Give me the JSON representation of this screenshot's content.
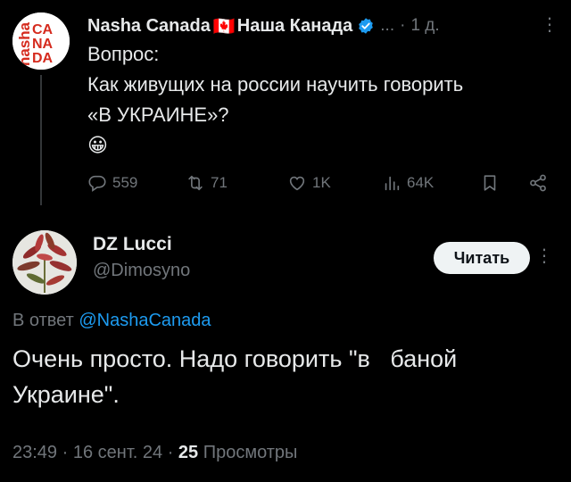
{
  "tweet": {
    "display_name": "Nasha Canada",
    "flag": "🇨🇦",
    "display_name_2": "Наша Канада",
    "ellipsis": "...",
    "separator": "·",
    "age": "1 д.",
    "more": "⋮",
    "text_lines": [
      "Вопрос:",
      "Как живущих на россии научить говорить",
      "«В УКРАИНЕ»?",
      "😀"
    ],
    "avatar_text": {
      "vertical": "nasha",
      "grid": [
        "CA",
        "NA",
        "DA"
      ]
    },
    "actions": {
      "replies": "559",
      "reposts": "71",
      "likes": "1K",
      "views": "64K"
    },
    "colors": {
      "verified": "#1d9bf0",
      "brand_red": "#d52b1e"
    }
  },
  "reply": {
    "display_name": "DZ Lucci",
    "handle": "@Dimosyno",
    "follow_label": "Читать",
    "more": "⋮",
    "in_reply_prefix": "В ответ ",
    "in_reply_mention": "@NashaCanada",
    "text_lines": [
      "Очень просто. Надо говорить \"в   баной",
      "Украине\"."
    ],
    "time": "23:49",
    "date": "16 сент. 24",
    "views_count": "25",
    "views_label": "Просмотры"
  }
}
